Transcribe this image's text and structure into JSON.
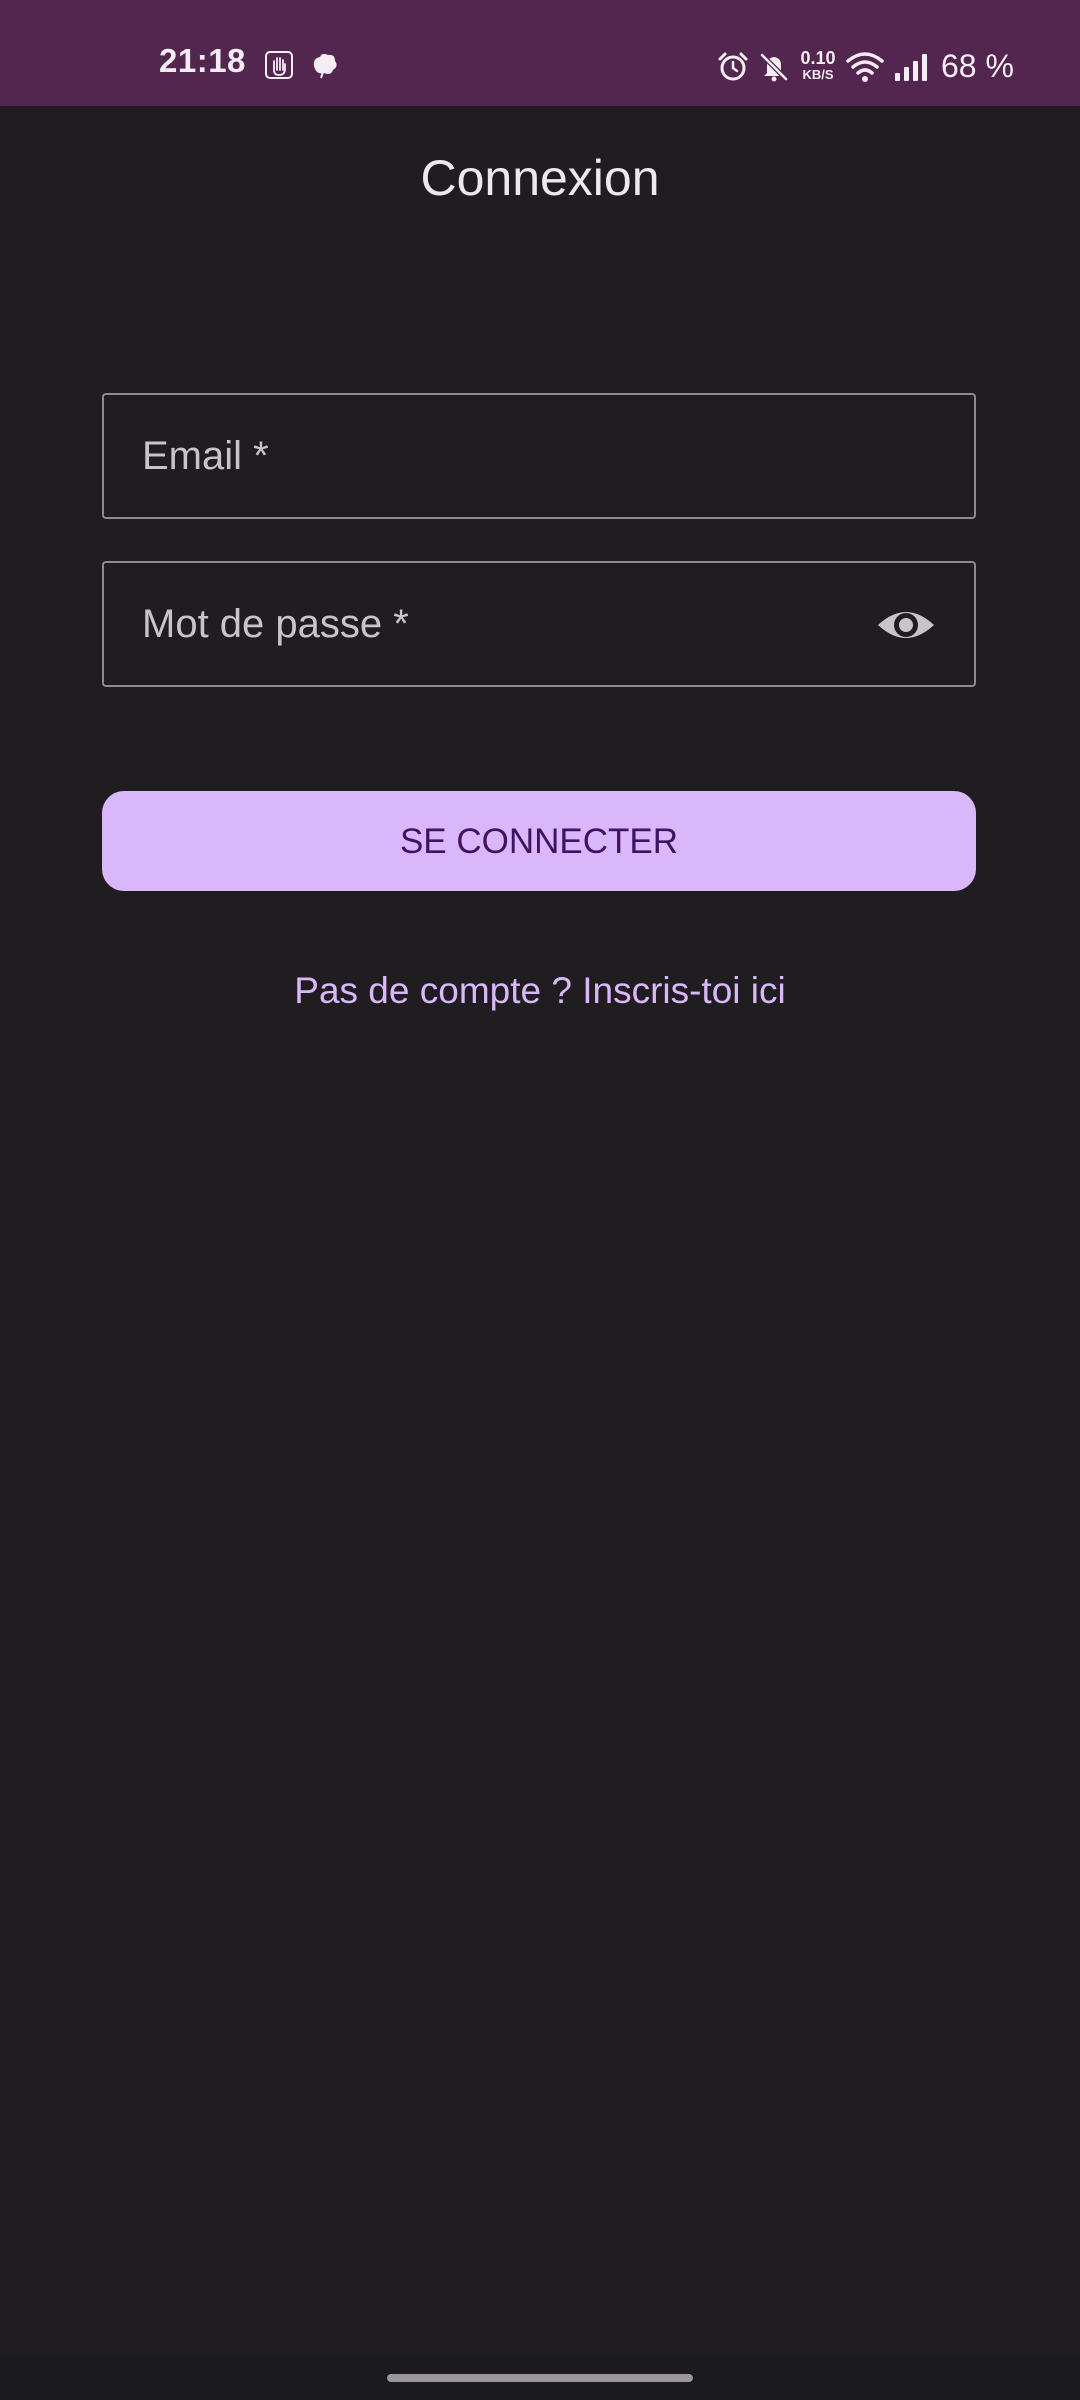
{
  "status_bar": {
    "time": "21:18",
    "left_icons": [
      "hand-notification-icon",
      "leaf-notification-icon"
    ],
    "right_icons": [
      "alarm-icon",
      "bell-off-icon",
      "wifi-icon",
      "signal-icon"
    ],
    "net_speed_value": "0.10",
    "net_speed_unit": "KB/S",
    "battery": "68 %",
    "background_color": "#53264f"
  },
  "screen": {
    "title": "Connexion",
    "background_color": "#1f1d20"
  },
  "form": {
    "email_placeholder": "Email *",
    "email_value": "",
    "password_placeholder": "Mot de passe *",
    "password_value": "",
    "password_toggle_icon": "eye-icon",
    "submit_label": "SE CONNECTER",
    "signup_link": "Pas de compte ? Inscris-toi ici",
    "accent_color": "#dab6fb",
    "button_text_color": "#3f1266"
  }
}
